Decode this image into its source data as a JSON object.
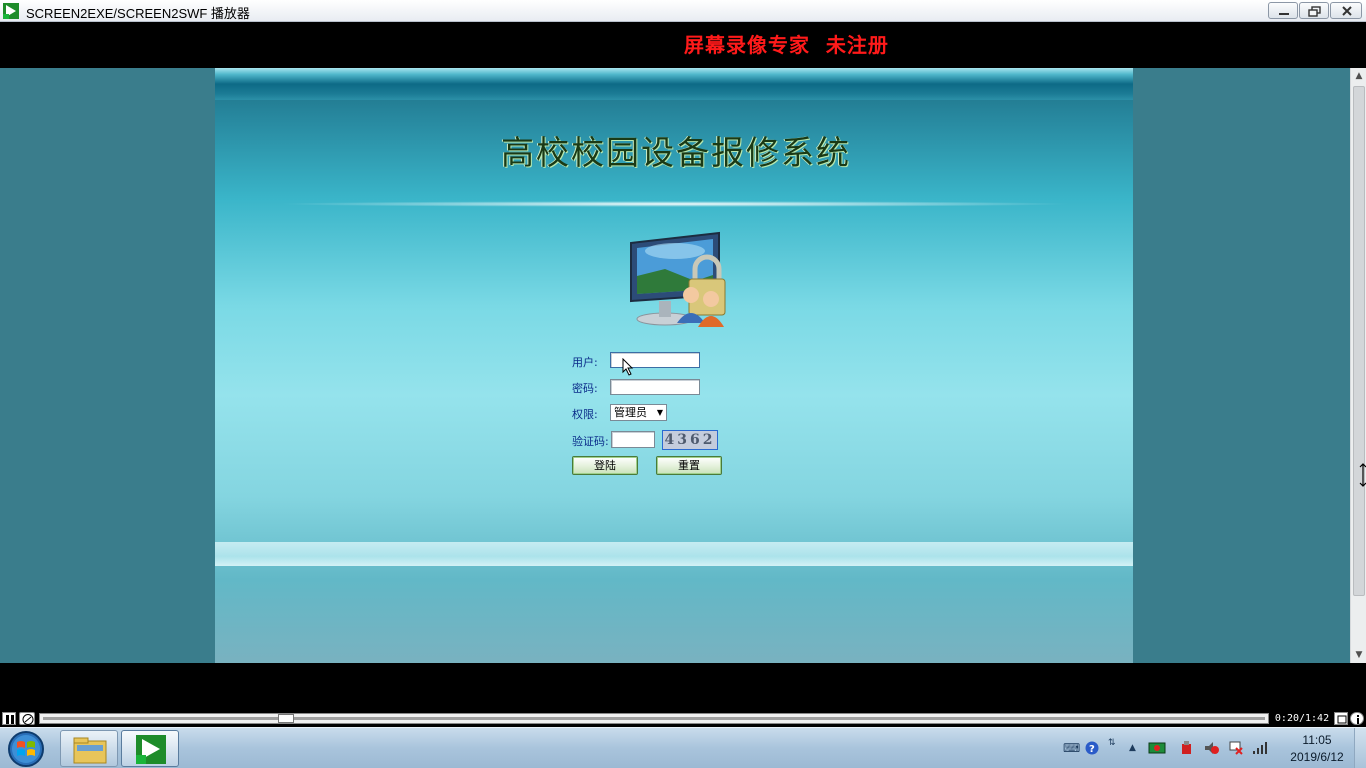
{
  "window": {
    "title": "SCREEN2EXE/SCREEN2SWF 播放器"
  },
  "banner": {
    "text": "屏幕录像专家  未注册",
    "color": "#ff1a1a"
  },
  "login_page": {
    "title": "高校校园设备报修系统",
    "form": {
      "username_label": "用户:",
      "username_value": "",
      "password_label": "密码:",
      "password_value": "",
      "role_label": "权限:",
      "role_selected": "管理员",
      "captcha_label": "验证码:",
      "captcha_value": "",
      "captcha_code": "4362",
      "login_button": "登陆",
      "reset_button": "重置"
    }
  },
  "player": {
    "time": "0:20/1:42",
    "progress_fraction": 0.196
  },
  "taskbar": {
    "tasks": [
      "explorer-icon",
      "screen2exe-player-icon"
    ],
    "tray_icons": [
      "keyboard-icon",
      "help-icon",
      "network-sync-icon",
      "show-hidden-icon",
      "display-icon",
      "usb-icon",
      "volume-muted-icon",
      "flag-error-icon",
      "signal-icon"
    ],
    "clock_time": "11:05",
    "clock_date": "2019/6/12"
  },
  "colors": {
    "viewport_bg": "#3a7d8c",
    "title_dark": "#1a3a16",
    "label_blue": "#0b2c8a"
  }
}
